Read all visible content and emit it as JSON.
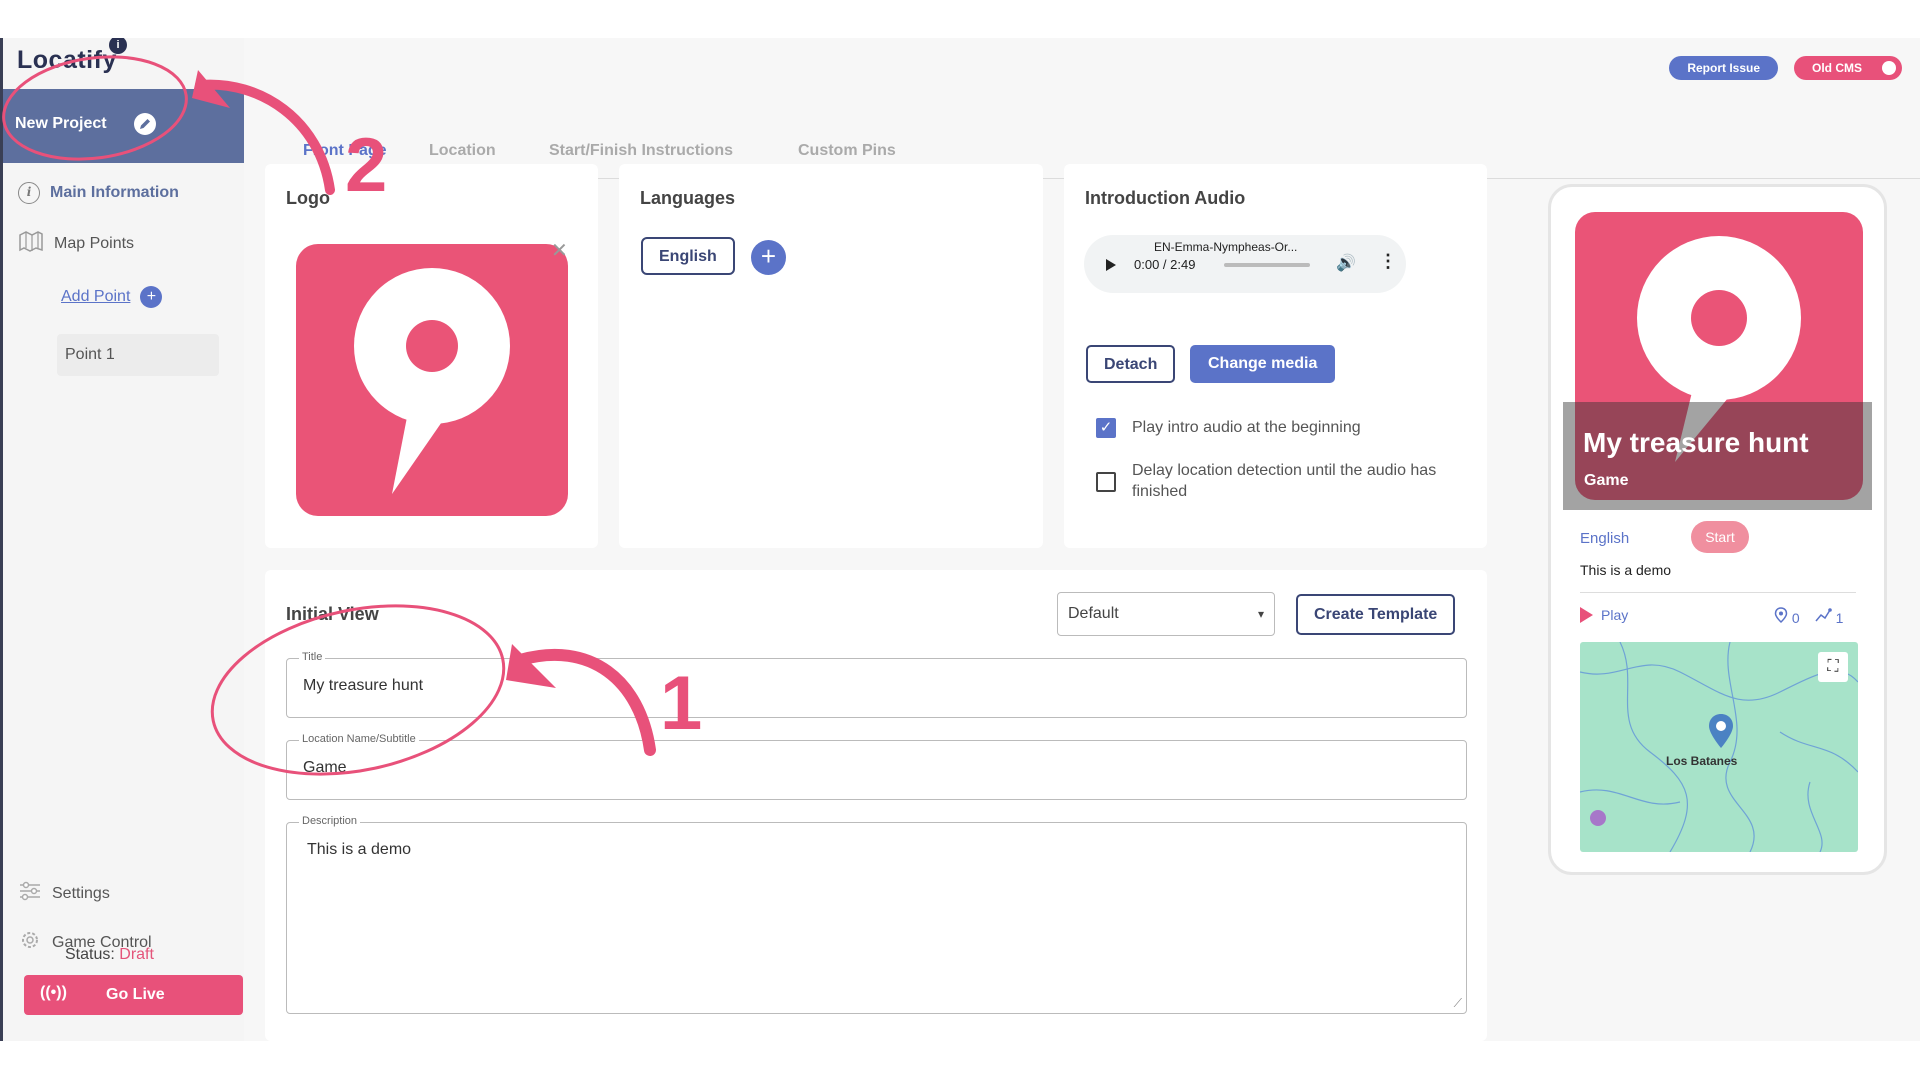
{
  "brand": {
    "name": "Locatify",
    "mark": "i"
  },
  "header": {
    "report_issue": "Report Issue",
    "old_cms": "Old CMS"
  },
  "project": {
    "name": "New Project"
  },
  "sidebar": {
    "main_information": "Main Information",
    "map_points": "Map Points",
    "add_point": "Add Point",
    "points": [
      {
        "label": "Point 1"
      }
    ],
    "settings": "Settings",
    "game_control": "Game Control",
    "status_label": "Status:",
    "status_value": "Draft",
    "go_live": "Go Live"
  },
  "tabs": [
    {
      "label": "Front Page",
      "active": true
    },
    {
      "label": "Location"
    },
    {
      "label": "Start/Finish Instructions"
    },
    {
      "label": "Custom Pins"
    }
  ],
  "logo_card": {
    "title": "Logo"
  },
  "languages_card": {
    "title": "Languages",
    "languages": [
      "English"
    ]
  },
  "audio_card": {
    "title": "Introduction Audio",
    "file_name": "EN-Emma-Nympheas-Or...",
    "time": "0:00 / 2:49",
    "detach": "Detach",
    "change_media": "Change media",
    "play_intro_label": "Play intro audio at the beginning",
    "play_intro_checked": true,
    "delay_label": "Delay location detection until the audio has finished",
    "delay_checked": false
  },
  "initial_view": {
    "title": "Initial View",
    "template_selected": "Default",
    "create_template": "Create Template",
    "title_label": "Title",
    "title_value": "My treasure hunt",
    "subtitle_label": "Location Name/Subtitle",
    "subtitle_value": "Game",
    "description_label": "Description",
    "description_value": "This is a demo"
  },
  "preview": {
    "title": "My treasure hunt",
    "subtitle": "Game",
    "language": "English",
    "start": "Start",
    "description": "This is a demo",
    "play": "Play",
    "pins_count": "0",
    "points_count": "1",
    "map_label": "Los Batanes"
  },
  "annotations": {
    "step1": "1",
    "step2": "2"
  },
  "colors": {
    "accent": "#5b73c8",
    "brand_pink": "#e8517a",
    "navy": "#3a4675"
  }
}
